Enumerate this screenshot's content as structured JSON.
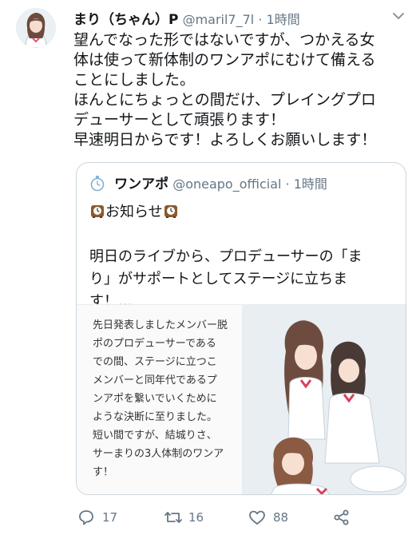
{
  "author": {
    "name": "まり（ちゃん）P",
    "handle": "@maril7_7l",
    "dot": "·",
    "time": "1時間"
  },
  "tweet_lines": [
    "望んでなった形ではないですが、つかえる女",
    "体は使って新体制のワンアポにむけて備える",
    "ことにしました。",
    "ほんとにちょっとの間だけ、プレイングプロ",
    "デューサーとして頑張ります！",
    "早速明日からです！よろしくお願いします！"
  ],
  "quote": {
    "name": "ワンアポ",
    "handle": "@oneapo_official",
    "dot": "·",
    "time": "1時間",
    "notice": "お知らせ",
    "body_lines": [
      "明日のライブから、プロデューサーの「ま",
      "り」がサポートとしてステージに立ちま",
      "す！..."
    ],
    "image_text_lines": [
      "先日発表しましたメンバー脱",
      "ポのプロデューサーである",
      "での間、ステージに立つこ",
      "メンバーと同年代であるプ",
      "ンアポを繋いでいくために",
      "ような決断に至りました。",
      "短い間ですが、結城りさ、",
      "サーまりの3人体制のワンア",
      "す！"
    ]
  },
  "actions": {
    "reply_count": "17",
    "retweet_count": "16",
    "like_count": "88"
  },
  "icons": {
    "reply": "reply-icon",
    "retweet": "retweet-icon",
    "like": "like-icon",
    "share": "share-icon",
    "menu": "chevron-down-icon",
    "clock": "mantel-clock-icon"
  },
  "colors": {
    "text": "#14171a",
    "secondary": "#657786",
    "border": "#ccd6dd"
  }
}
